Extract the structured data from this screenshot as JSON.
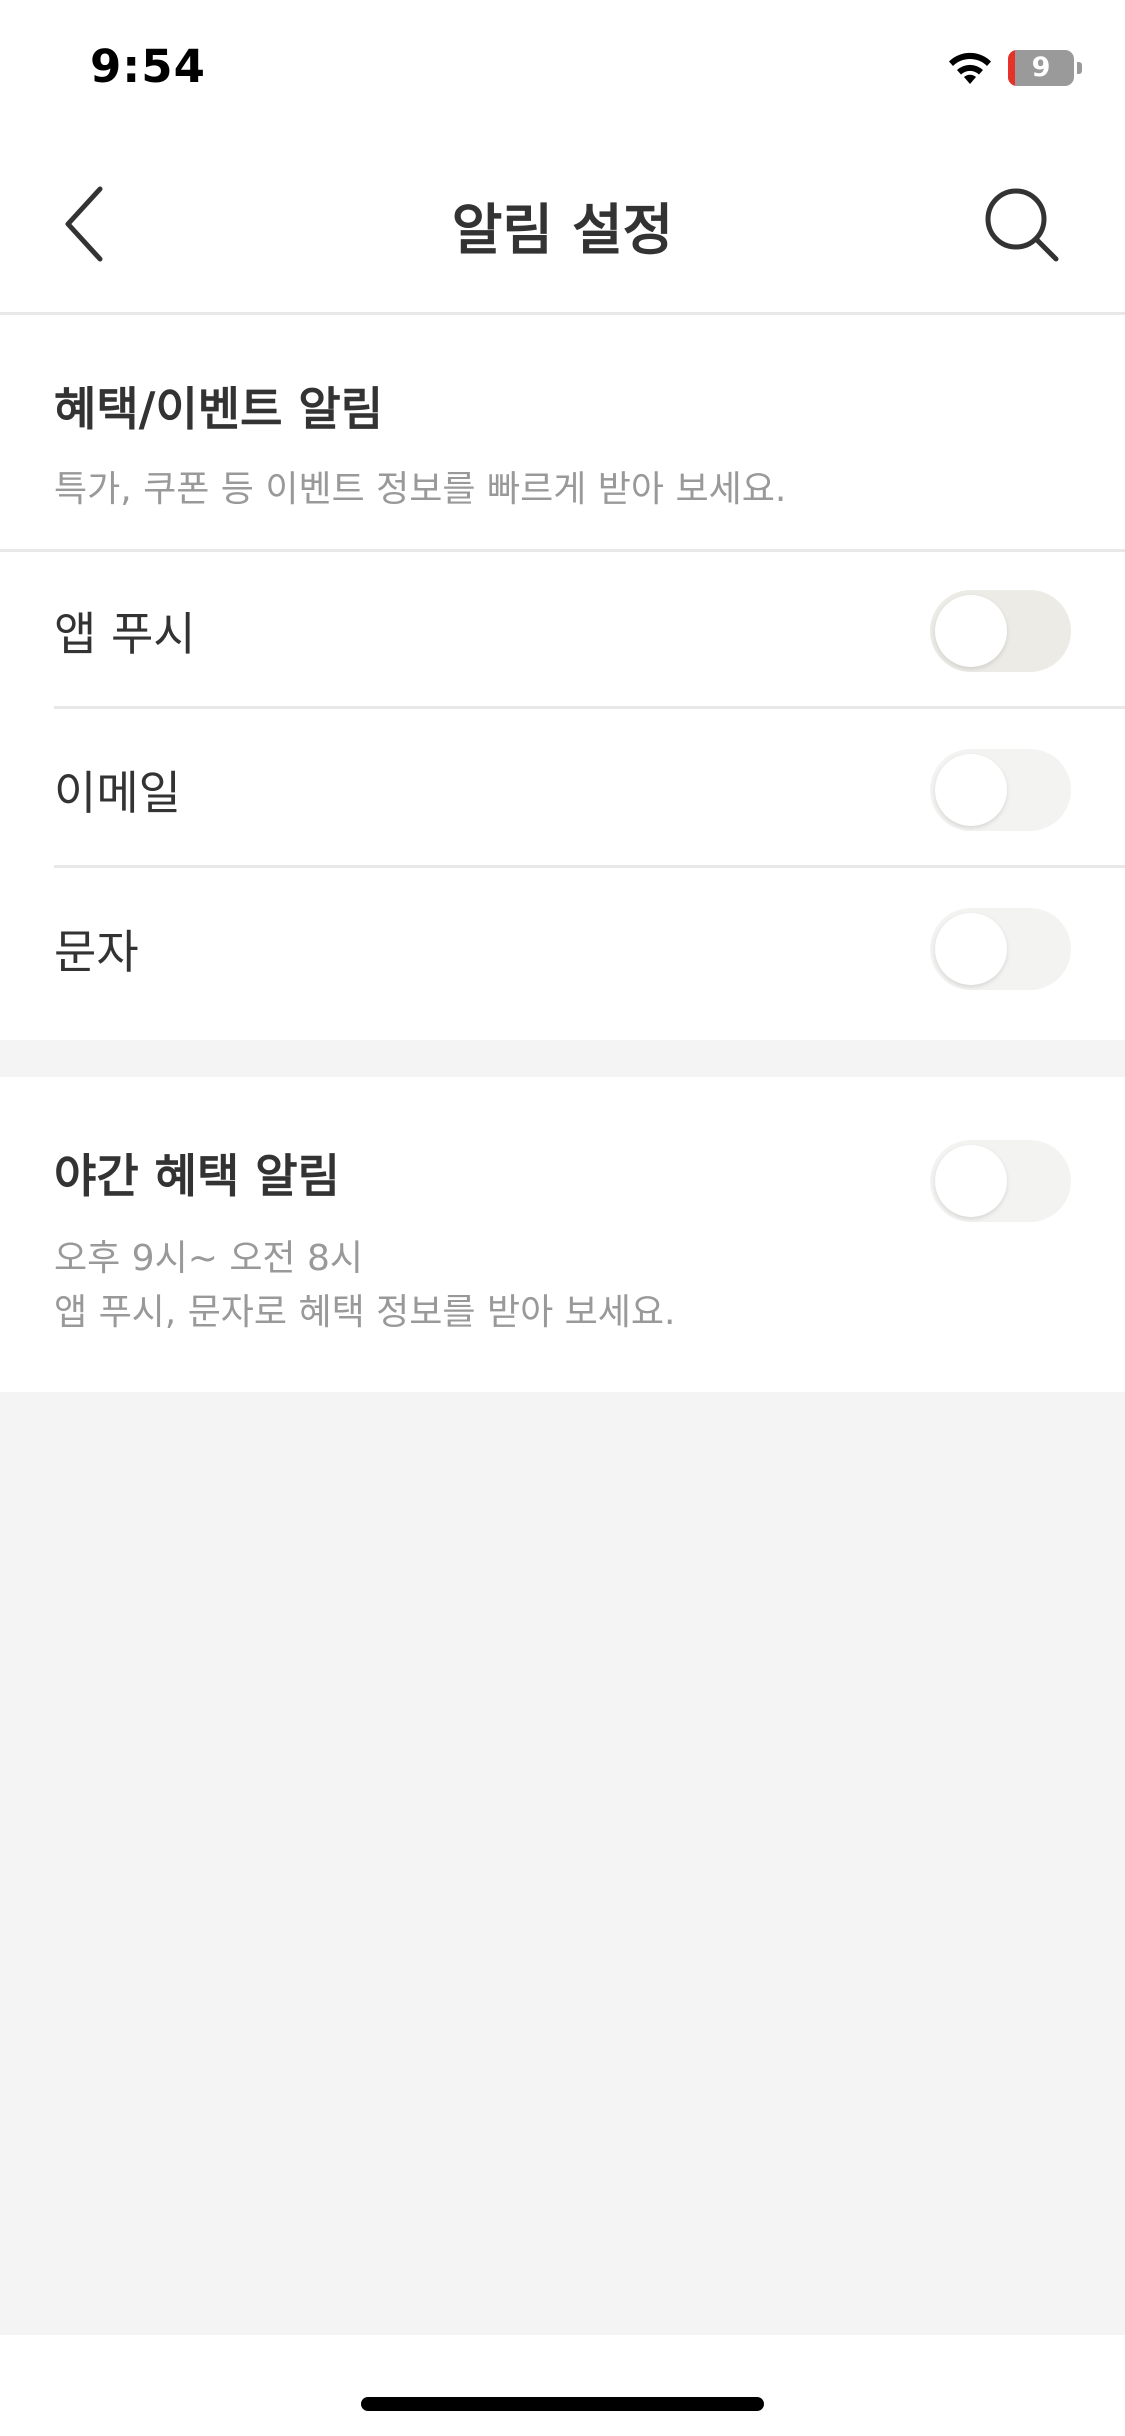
{
  "status_bar": {
    "time": "9:54",
    "battery_level": "9"
  },
  "header": {
    "title": "알림 설정",
    "back_icon": "chevron-left-icon",
    "search_icon": "search-icon"
  },
  "benefit_section": {
    "title": "혜택/이벤트 알림",
    "description": "특가, 쿠폰 등 이벤트 정보를 빠르게 받아 보세요.",
    "rows": [
      {
        "label": "앱 푸시",
        "enabled": false
      },
      {
        "label": "이메일",
        "enabled": false
      },
      {
        "label": "문자",
        "enabled": false
      }
    ]
  },
  "night_section": {
    "title": "야간 혜택 알림",
    "time_range": "오후 9시~ 오전 8시",
    "description": "앱 푸시, 문자로 혜택 정보를 받아 보세요.",
    "enabled": false
  },
  "colors": {
    "background": "#f4f4f4",
    "surface": "#ffffff",
    "text_primary": "#333333",
    "text_secondary": "#999999",
    "toggle_off": "#ecebe6",
    "battery_low": "#e5332a"
  }
}
